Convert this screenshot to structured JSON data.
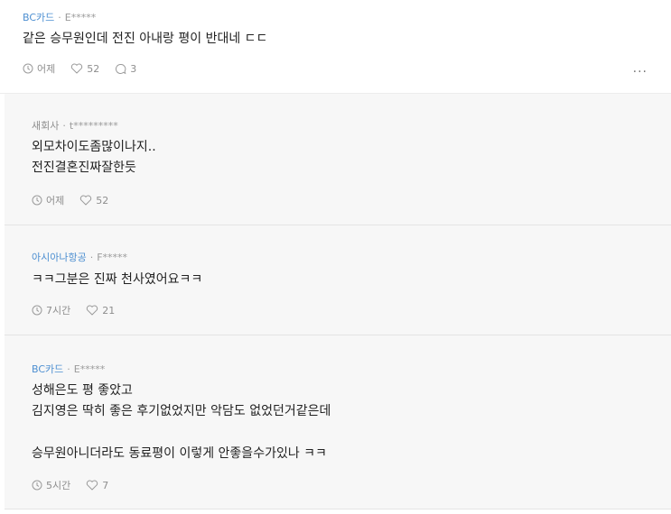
{
  "post": {
    "company": "BC카드",
    "author": "E*****",
    "body": [
      "같은 승무원인데 전진 아내랑 평이 반대네 ㄷㄷ"
    ],
    "time": "어제",
    "likes": "52",
    "comments": "3",
    "more": "···"
  },
  "replies": [
    {
      "company": "새회사",
      "author": "t*********",
      "company_color": "#8e8e8e",
      "lines": [
        "외모차이도좀많이나지..",
        "전진결혼진짜잘한듯"
      ],
      "time": "어제",
      "likes": "52"
    },
    {
      "company": "아시아나항공",
      "author": "F*****",
      "company_color": "#4d8fd1",
      "lines": [
        "ㅋㅋ그분은 진짜 천사였어요ㅋㅋ"
      ],
      "time": "7시간",
      "likes": "21"
    },
    {
      "company": "BC카드",
      "author": "E*****",
      "company_color": "#4d8fd1",
      "lines": [
        "성해은도 평 좋았고",
        "김지영은 딱히 좋은 후기없었지만 악담도 없었던거같은데",
        "",
        "승무원아니더라도 동료평이 이렇게 안좋을수가있나 ㅋㅋ"
      ],
      "time": "5시간",
      "likes": "7"
    }
  ]
}
